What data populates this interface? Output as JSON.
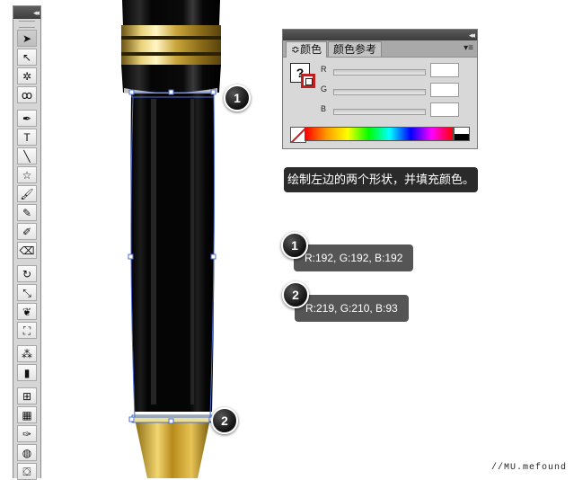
{
  "tools_panel": {
    "collapse_glyph": "◂◂",
    "tools": [
      {
        "name": "selection-tool",
        "glyph": "➤",
        "active": true
      },
      {
        "name": "direct-selection-tool",
        "glyph": "↖"
      },
      {
        "name": "magic-wand-tool",
        "glyph": "✲"
      },
      {
        "name": "lasso-tool",
        "glyph": "ꝏ"
      },
      {
        "sep": true
      },
      {
        "name": "pen-tool",
        "glyph": "✒"
      },
      {
        "name": "type-tool",
        "glyph": "T"
      },
      {
        "name": "line-segment-tool",
        "glyph": "╲"
      },
      {
        "name": "star-tool",
        "glyph": "☆"
      },
      {
        "name": "paintbrush-tool",
        "glyph": "🖌"
      },
      {
        "name": "pencil-tool",
        "glyph": "✎"
      },
      {
        "name": "blob-brush-tool",
        "glyph": "✐"
      },
      {
        "name": "eraser-tool",
        "glyph": "⌫"
      },
      {
        "sep": true
      },
      {
        "name": "rotate-tool",
        "glyph": "↻"
      },
      {
        "name": "scale-tool",
        "glyph": "⤡"
      },
      {
        "name": "warp-tool",
        "glyph": "❦"
      },
      {
        "name": "free-transform-tool",
        "glyph": "⛶"
      },
      {
        "sep": true
      },
      {
        "name": "symbol-sprayer-tool",
        "glyph": "⁂"
      },
      {
        "name": "column-graph-tool",
        "glyph": "▮"
      },
      {
        "sep": true
      },
      {
        "name": "mesh-tool",
        "glyph": "⊞"
      },
      {
        "name": "gradient-tool",
        "glyph": "▦"
      },
      {
        "name": "eyedropper-tool",
        "glyph": "✑"
      },
      {
        "name": "blend-tool",
        "glyph": "◍"
      },
      {
        "name": "live-paint-bucket-tool",
        "glyph": "⛋"
      }
    ]
  },
  "color_panel": {
    "collapse_glyph": "◂◂",
    "tabs": [
      {
        "label": "颜色",
        "active": true,
        "prefix": "≎"
      },
      {
        "label": "颜色参考",
        "active": false
      }
    ],
    "menu_glyph": "▾≡",
    "fill_glyph": "?",
    "channels": [
      {
        "label": "R",
        "value": ""
      },
      {
        "label": "G",
        "value": ""
      },
      {
        "label": "B",
        "value": ""
      }
    ]
  },
  "instruction": {
    "text": "绘制左边的两个形状，并填充颜色。"
  },
  "steps": [
    {
      "number": "1",
      "label": "R:192, G:192, B:192"
    },
    {
      "number": "2",
      "label": "R:219, G:210, B:93"
    }
  ],
  "pen_badges": [
    "1",
    "2"
  ],
  "watermark": "//MU.mefound",
  "colors": {
    "selection_blue": "#4a6cd4",
    "gold": "#d4b24a",
    "body_black": "#0a0a0a",
    "label_bg": "#555555",
    "instruction_bg": "#2a2a2a"
  }
}
